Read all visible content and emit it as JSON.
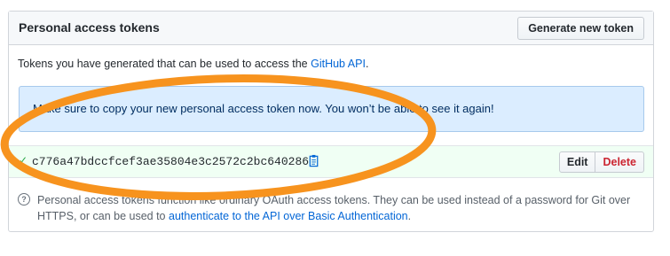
{
  "panel": {
    "title": "Personal access tokens",
    "generate_button": "Generate new token"
  },
  "description": {
    "prefix": "Tokens you have generated that can be used to access the ",
    "link": "GitHub API",
    "suffix": "."
  },
  "flash": {
    "message": "Make sure to copy your new personal access token now. You won’t be able to see it again!"
  },
  "token": {
    "check_icon": "check-icon",
    "value": "c776a47bdccfcef3ae35804e3c2572c2bc640286",
    "copy_icon": "clipboard-icon",
    "edit_label": "Edit",
    "delete_label": "Delete"
  },
  "help": {
    "icon": "question-icon",
    "text_prefix": "Personal access tokens function like ordinary OAuth access tokens. They can be used instead of a password for Git over HTTPS, or can be used to ",
    "link": "authenticate to the API over Basic Authentication",
    "text_suffix": "."
  },
  "annotation": {
    "color": "#f7931e"
  }
}
